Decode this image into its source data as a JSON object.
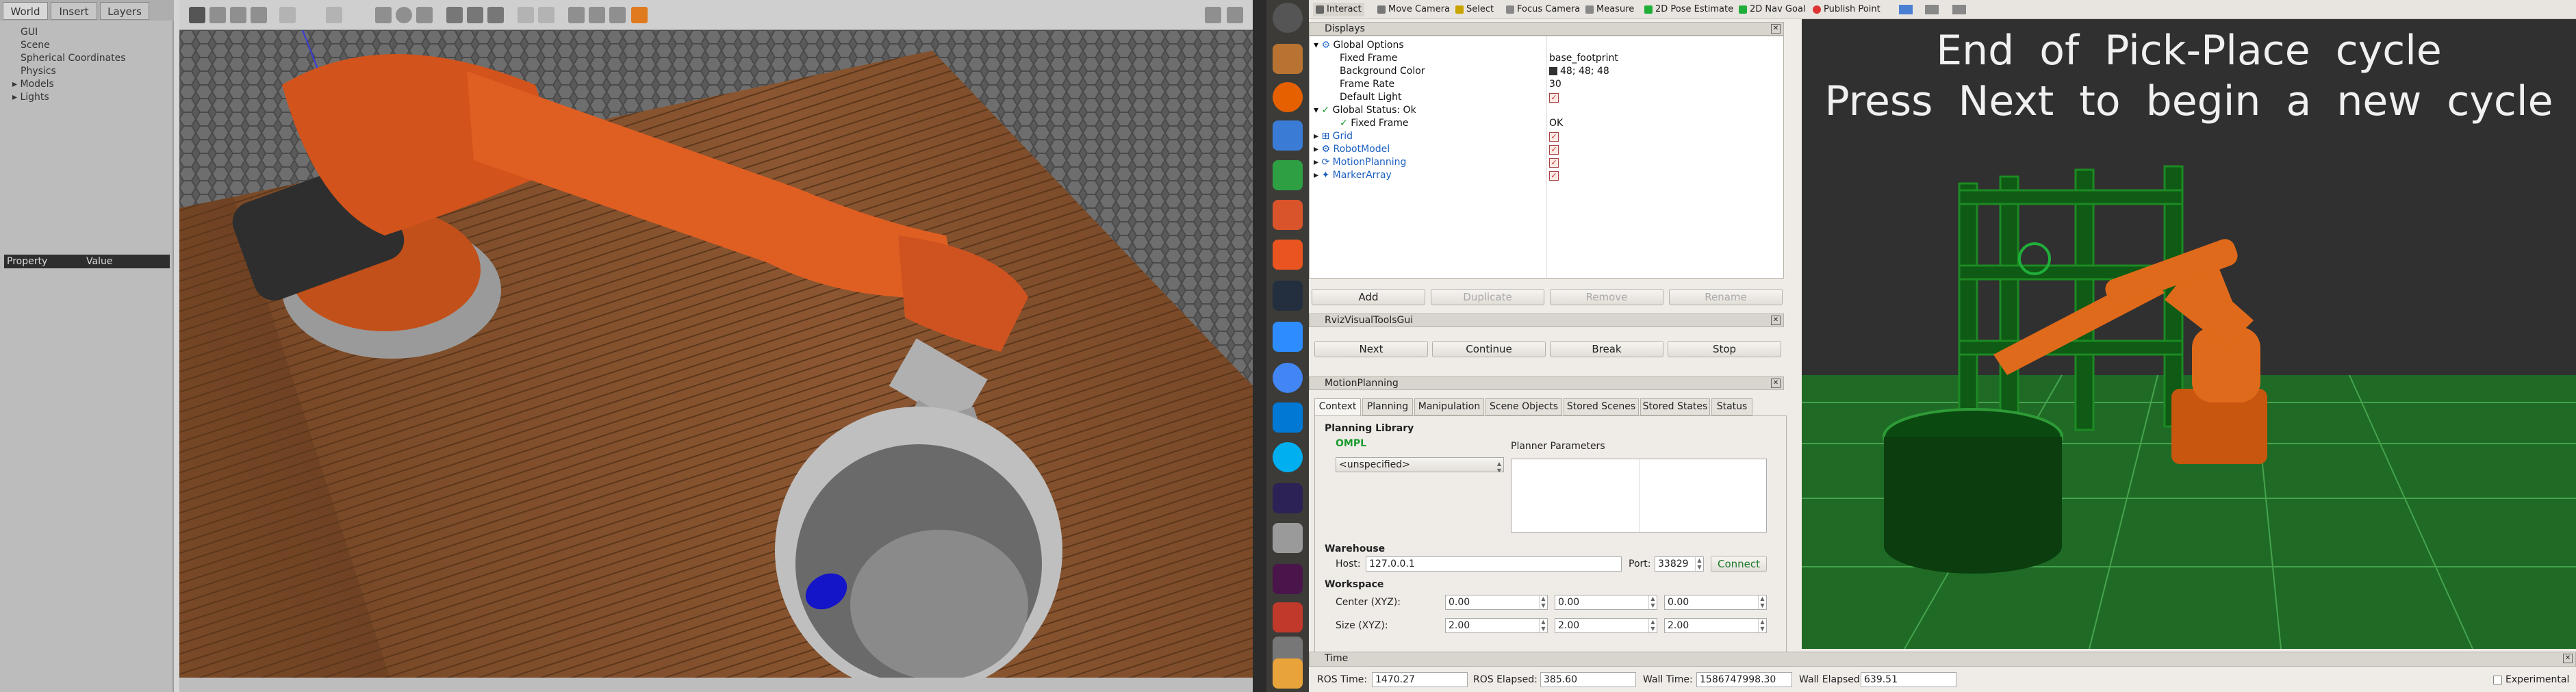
{
  "gazebo": {
    "tabs": [
      "World",
      "Insert",
      "Layers"
    ],
    "tree": [
      "GUI",
      "Scene",
      "Spherical Coordinates",
      "Physics",
      "Models",
      "Lights"
    ],
    "property_header": {
      "property": "Property",
      "value": "Value"
    }
  },
  "rviz": {
    "toolbar": [
      "Interact",
      "Move Camera",
      "Select",
      "Focus Camera",
      "Measure",
      "2D Pose Estimate",
      "2D Nav Goal",
      "Publish Point"
    ],
    "displays": {
      "title": "Displays",
      "global_options": "Global Options",
      "fixed_frame_label": "Fixed Frame",
      "fixed_frame_value": "base_footprint",
      "background_color_label": "Background Color",
      "background_color_value": "48; 48; 48",
      "frame_rate_label": "Frame Rate",
      "frame_rate_value": "30",
      "default_light_label": "Default Light",
      "global_status": "Global Status: Ok",
      "fixed_frame_status_label": "Fixed Frame",
      "fixed_frame_status_value": "OK",
      "items": [
        "Grid",
        "RobotModel",
        "MotionPlanning",
        "MarkerArray"
      ],
      "buttons": {
        "add": "Add",
        "duplicate": "Duplicate",
        "remove": "Remove",
        "rename": "Rename"
      }
    },
    "visual_tools": {
      "title": "RvizVisualToolsGui",
      "buttons": {
        "next": "Next",
        "continue": "Continue",
        "break": "Break",
        "stop": "Stop"
      }
    },
    "motion_planning": {
      "title": "MotionPlanning",
      "tabs": [
        "Context",
        "Planning",
        "Manipulation",
        "Scene Objects",
        "Stored Scenes",
        "Stored States",
        "Status"
      ],
      "planning_library": "Planning Library",
      "library_name": "OMPL",
      "planner_select": "<unspecified>",
      "planner_parameters": "Planner Parameters",
      "warehouse": "Warehouse",
      "host_label": "Host:",
      "host_value": "127.0.0.1",
      "port_label": "Port:",
      "port_value": "33829",
      "connect": "Connect",
      "workspace": "Workspace",
      "center_label": "Center (XYZ):",
      "center": [
        "0.00",
        "0.00",
        "0.00"
      ],
      "size_label": "Size (XYZ):",
      "size": [
        "2.00",
        "2.00",
        "2.00"
      ]
    },
    "view_text": {
      "line1": "End of Pick-Place cycle",
      "line2": "Press Next to begin a new cycle"
    },
    "time": {
      "title": "Time",
      "ros_time_label": "ROS Time:",
      "ros_time": "1470.27",
      "ros_elapsed_label": "ROS Elapsed:",
      "ros_elapsed": "385.60",
      "wall_time_label": "Wall Time:",
      "wall_time": "1586747998.30",
      "wall_elapsed_label": "Wall Elapsed:",
      "wall_elapsed": "639.51",
      "experimental": "Experimental"
    }
  },
  "colors": {
    "robot_orange": "#d9561c",
    "grid_green": "#2e7d32",
    "rviz_bg": "#303030",
    "launcher": "#3c3b37"
  }
}
